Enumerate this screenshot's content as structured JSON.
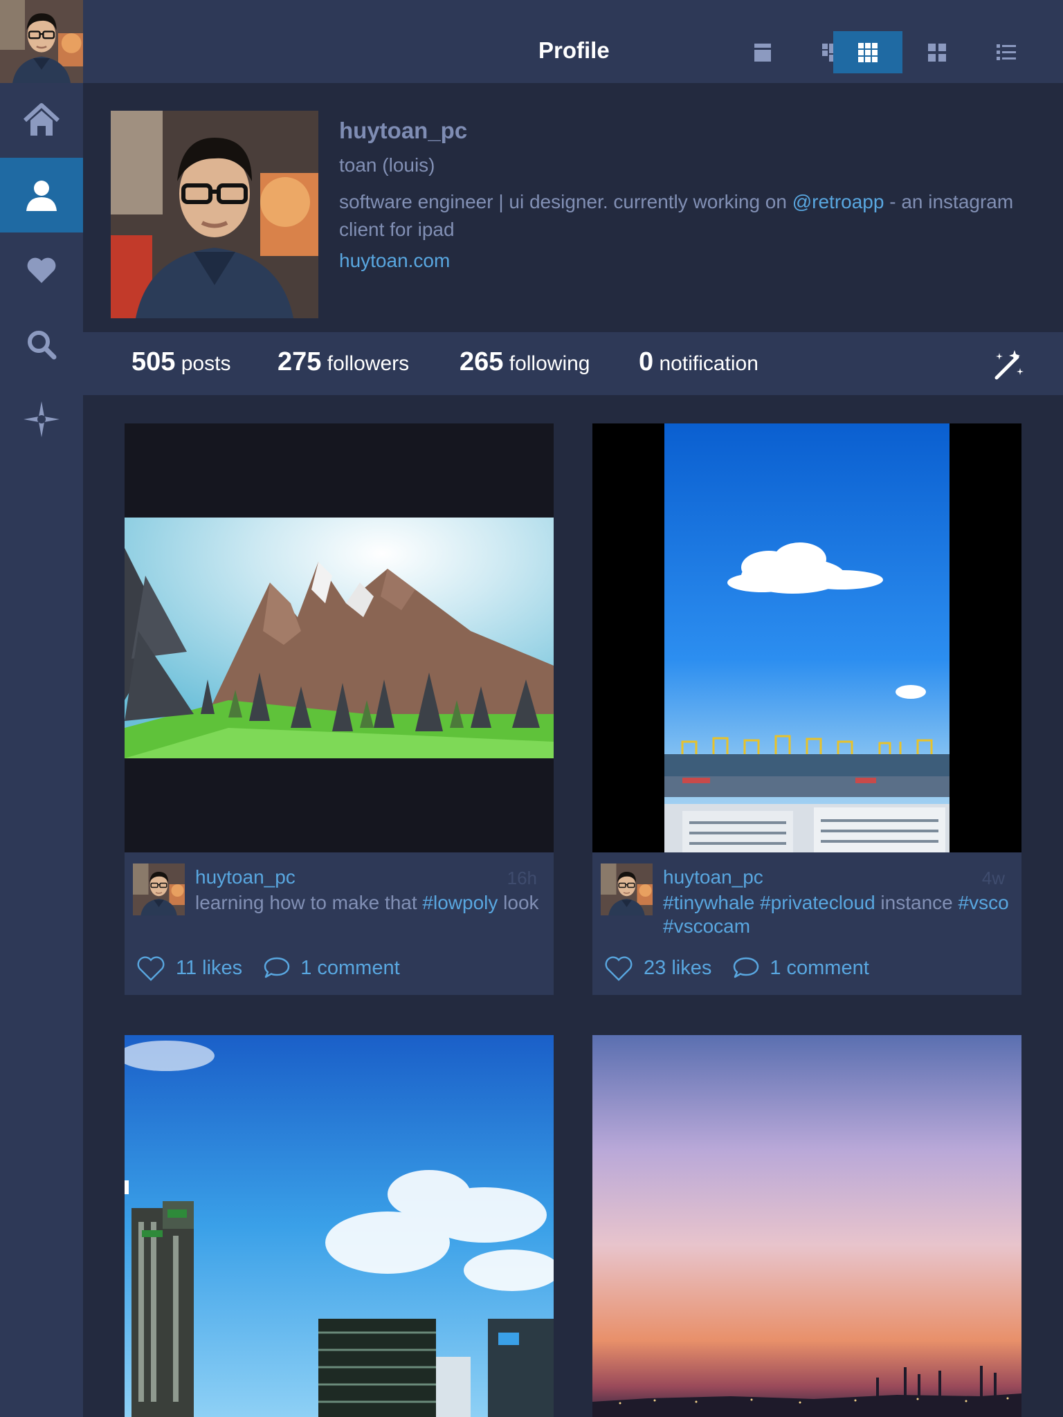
{
  "header": {
    "title": "Profile",
    "view_modes": [
      {
        "name": "single-view",
        "active": false
      },
      {
        "name": "masonry-view",
        "active": false
      },
      {
        "name": "grid-view",
        "active": true
      },
      {
        "name": "large-grid-view",
        "active": false
      },
      {
        "name": "list-view",
        "active": false
      }
    ]
  },
  "sidebar": {
    "items": [
      {
        "name": "home",
        "icon": "home-icon",
        "active": false
      },
      {
        "name": "profile",
        "icon": "user-icon",
        "active": true
      },
      {
        "name": "likes",
        "icon": "heart-icon",
        "active": false
      },
      {
        "name": "search",
        "icon": "search-icon",
        "active": false
      },
      {
        "name": "explore",
        "icon": "compass-star-icon",
        "active": false
      }
    ]
  },
  "profile": {
    "username": "huytoan_pc",
    "full_name": "toan (louis)",
    "bio_before": "software engineer | ui designer. currently working on ",
    "bio_mention": "@retroapp",
    "bio_after": " - an instagram client for ipad",
    "website": "huytoan.com"
  },
  "stats": {
    "posts_count": "505",
    "posts_label": "posts",
    "followers_count": "275",
    "followers_label": "followers",
    "following_count": "265",
    "following_label": "following",
    "notification_count": "0",
    "notification_label": "notification"
  },
  "posts": [
    {
      "username": "huytoan_pc",
      "time": "16h",
      "caption_before": "learning how to make that ",
      "caption_tag": "#lowpoly",
      "caption_after": " look",
      "likes": "11 likes",
      "comments": "1 comment"
    },
    {
      "username": "huytoan_pc",
      "time": "4w",
      "caption_tag1": "#tinywhale",
      "caption_tag2": "#privatecloud",
      "caption_mid": " instance ",
      "caption_tag3": "#vsco",
      "caption_tag4": "#vscocam",
      "likes": "23 likes",
      "comments": "1 comment"
    }
  ],
  "colors": {
    "background": "#232a3f",
    "panel": "#2e3957",
    "accent": "#1f6aa3",
    "link": "#59a7e0",
    "muted_text": "#8290b5"
  }
}
